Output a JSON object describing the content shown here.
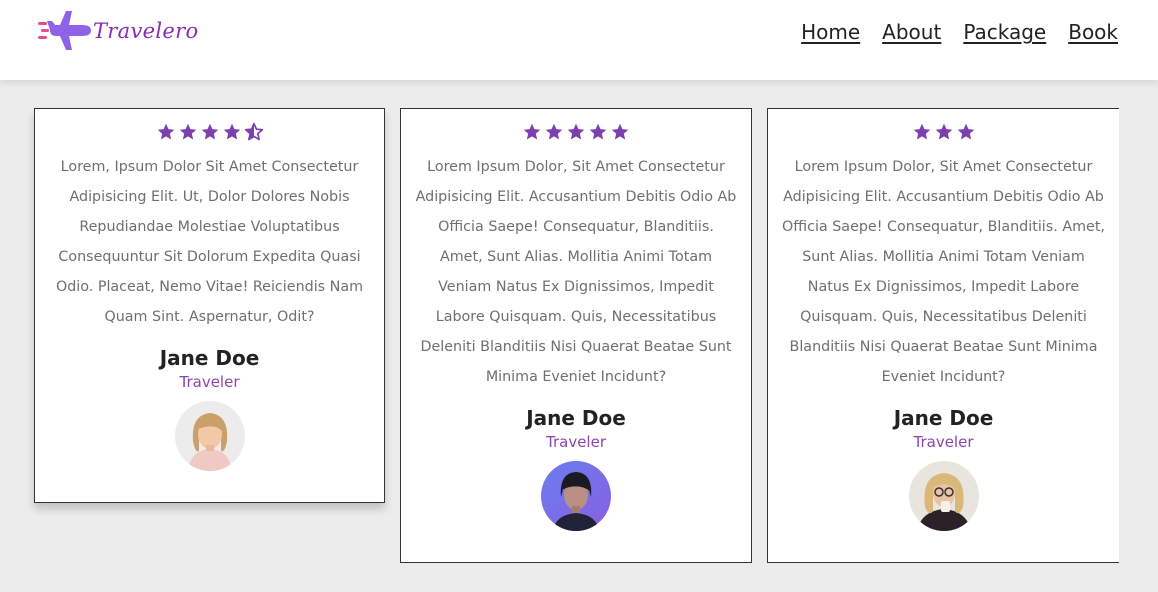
{
  "brand": {
    "name": "Travelero",
    "icon": "airplane-icon",
    "accent": "#8e44ad"
  },
  "nav": {
    "items": [
      {
        "label": "Home"
      },
      {
        "label": "About"
      },
      {
        "label": "Package"
      },
      {
        "label": "Book"
      }
    ]
  },
  "colors": {
    "star": "#7d3fb0",
    "role": "#8e44ad",
    "background": "#ececec"
  },
  "testimonials": [
    {
      "rating": 4.5,
      "quote": "Lorem, Ipsum Dolor Sit Amet Consectetur Adipisicing Elit. Ut, Dolor Dolores Nobis Repudiandae Molestiae Voluptatibus Consequuntur Sit Dolorum Expedita Quasi Odio. Placeat, Nemo Vitae! Reiciendis Nam Quam Sint. Aspernatur, Odit?",
      "name": "Jane Doe",
      "role": "Traveler"
    },
    {
      "rating": 5,
      "quote": "Lorem Ipsum Dolor, Sit Amet Consectetur Adipisicing Elit. Accusantium Debitis Odio Ab Officia Saepe! Consequatur, Blanditiis. Amet, Sunt Alias. Mollitia Animi Totam Veniam Natus Ex Dignissimos, Impedit Labore Quisquam. Quis, Necessitatibus Deleniti Blanditiis Nisi Quaerat Beatae Sunt Minima Eveniet Incidunt?",
      "name": "Jane Doe",
      "role": "Traveler"
    },
    {
      "rating": 3,
      "quote": "Lorem Ipsum Dolor, Sit Amet Consectetur Adipisicing Elit. Accusantium Debitis Odio Ab Officia Saepe! Consequatur, Blanditiis. Amet, Sunt Alias. Mollitia Animi Totam Veniam Natus Ex Dignissimos, Impedit Labore Quisquam. Quis, Necessitatibus Deleniti Blanditiis Nisi Quaerat Beatae Sunt Minima Eveniet Incidunt?",
      "name": "Jane Doe",
      "role": "Traveler"
    }
  ]
}
